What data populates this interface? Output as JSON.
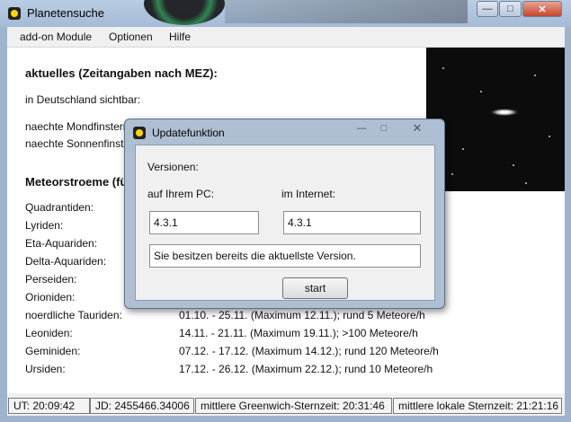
{
  "window": {
    "title": "Planetensuche",
    "controls": {
      "minimize": "—",
      "maximize": "□",
      "close": "✕"
    }
  },
  "menu": {
    "items": [
      "add-on Module",
      "Optionen",
      "Hilfe"
    ]
  },
  "content": {
    "heading_current": "aktuelles (Zeitangaben nach MEZ):",
    "visible_label": "in Deutschland sichtbar:",
    "next_lunar": "naechte Mondfinsternis:",
    "next_solar": "naechte Sonnenfinsternis:",
    "heading_meteors": "Meteorstroeme (für 2010):",
    "meteors": [
      {
        "name": "Quadrantiden:",
        "info": ""
      },
      {
        "name": "Lyriden:",
        "info": ""
      },
      {
        "name": "Eta-Aquariden:",
        "info": ""
      },
      {
        "name": "Delta-Aquariden:",
        "info": ""
      },
      {
        "name": "Perseiden:",
        "info": ""
      },
      {
        "name": "Orioniden:",
        "info": ""
      },
      {
        "name": "noerdliche Tauriden:",
        "info": "01.10. - 25.11. (Maximum 12.11.); rund 5 Meteore/h"
      },
      {
        "name": "Leoniden:",
        "info": "14.11. - 21.11. (Maximum 19.11.); >100 Meteore/h"
      },
      {
        "name": "Geminiden:",
        "info": "07.12. - 17.12. (Maximum 14.12.); rund 120 Meteore/h"
      },
      {
        "name": "Ursiden:",
        "info": "17.12. - 26.12. (Maximum 22.12.); rund 10 Meteore/h"
      }
    ]
  },
  "status": {
    "ut": "UT: 20:09:42",
    "jd": "JD: 2455466.34006",
    "gmst": "mittlere Greenwich-Sternzeit: 20:31:46",
    "lmst": "mittlere lokale Sternzeit: 21:21:16"
  },
  "dialog": {
    "title": "Updatefunktion",
    "controls": {
      "minimize": "—",
      "maximize": "□",
      "close": "✕"
    },
    "versions_label": "Versionen:",
    "pc_label": "auf Ihrem PC:",
    "internet_label": "im Internet:",
    "pc_version": "4.3.1",
    "internet_version": "4.3.1",
    "message": "Sie besitzen bereits die aktuellste Version.",
    "start_label": "start"
  },
  "icons": {
    "app": "app-logo-icon"
  }
}
